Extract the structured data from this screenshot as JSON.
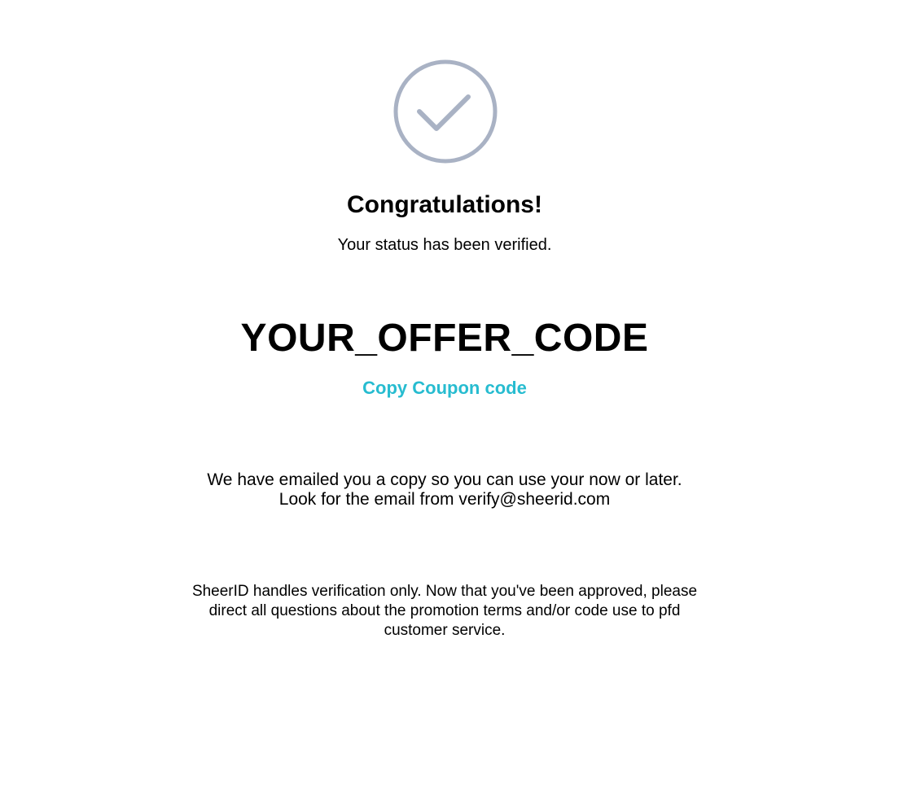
{
  "icon": {
    "name": "checkmark-circle-icon",
    "color": "#a9b2c4"
  },
  "header": {
    "title": "Congratulations!",
    "subtitle": "Your status has been verified."
  },
  "offer": {
    "code": "YOUR_OFFER_CODE",
    "copy_label": "Copy Coupon code",
    "accent_color": "#27bcd0"
  },
  "email_note": {
    "line1": "We have emailed you a copy so you can use your now or later.",
    "line2": "Look for the email from verify@sheerid.com"
  },
  "disclaimer": {
    "text": "SheerID handles verification only. Now that you've been approved, please direct all questions about the promotion terms and/or code use to pfd customer service."
  }
}
